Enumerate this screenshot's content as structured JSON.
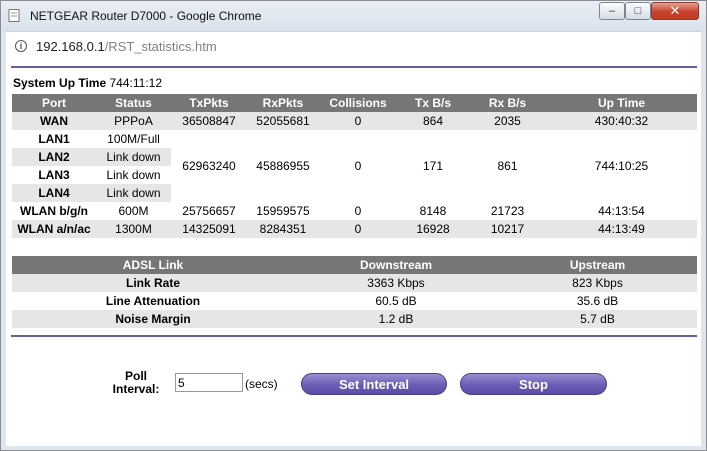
{
  "window": {
    "title": "NETGEAR Router D7000 - Google Chrome",
    "minimize": "–",
    "maximize": "□",
    "close": "✕"
  },
  "address": {
    "host": "192.168.0.1",
    "path": "/RST_statistics.htm"
  },
  "uptime": {
    "label": "System Up Time",
    "value": "744:11:12"
  },
  "port_table": {
    "headers": [
      "Port",
      "Status",
      "TxPkts",
      "RxPkts",
      "Collisions",
      "Tx B/s",
      "Rx B/s",
      "Up Time"
    ],
    "wan": {
      "port": "WAN",
      "status": "PPPoA",
      "txpkts": "36508847",
      "rxpkts": "52055681",
      "collisions": "0",
      "txbs": "864",
      "rxbs": "2035",
      "uptime": "430:40:32"
    },
    "lan": {
      "ports": [
        {
          "port": "LAN1",
          "status": "100M/Full"
        },
        {
          "port": "LAN2",
          "status": "Link down"
        },
        {
          "port": "LAN3",
          "status": "Link down"
        },
        {
          "port": "LAN4",
          "status": "Link down"
        }
      ],
      "txpkts": "62963240",
      "rxpkts": "45886955",
      "collisions": "0",
      "txbs": "171",
      "rxbs": "861",
      "uptime": "744:10:25"
    },
    "wlan_bgn": {
      "port": "WLAN b/g/n",
      "status": "600M",
      "txpkts": "25756657",
      "rxpkts": "15959575",
      "collisions": "0",
      "txbs": "8148",
      "rxbs": "21723",
      "uptime": "44:13:54"
    },
    "wlan_anac": {
      "port": "WLAN a/n/ac",
      "status": "1300M",
      "txpkts": "14325091",
      "rxpkts": "8284351",
      "collisions": "0",
      "txbs": "16928",
      "rxbs": "10217",
      "uptime": "44:13:49"
    }
  },
  "adsl_table": {
    "headers": [
      "ADSL Link",
      "Downstream",
      "Upstream"
    ],
    "rows": [
      {
        "label": "Link Rate",
        "down": "3363 Kbps",
        "up": "823 Kbps"
      },
      {
        "label": "Line Attenuation",
        "down": "60.5 dB",
        "up": "35.6 dB"
      },
      {
        "label": "Noise Margin",
        "down": "1.2 dB",
        "up": "5.7 dB"
      }
    ]
  },
  "poll": {
    "label_line1": "Poll",
    "label_line2": "Interval:",
    "value": "5",
    "unit": "(secs)"
  },
  "buttons": {
    "set_interval": "Set Interval",
    "stop": "Stop"
  },
  "colors": {
    "accent": "#6b5a9c",
    "header_gray": "#767676",
    "row_alt": "#e6e6e6"
  }
}
